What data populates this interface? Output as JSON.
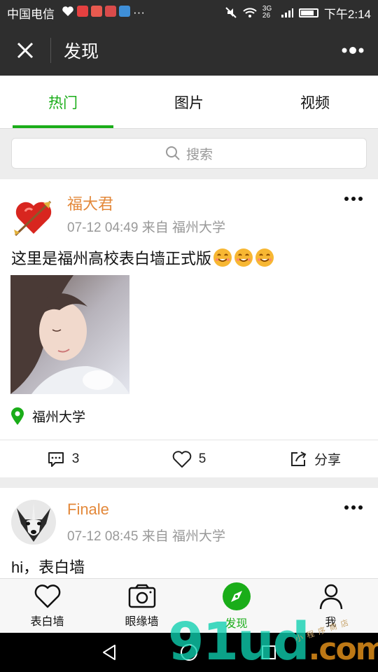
{
  "status_bar": {
    "carrier": "中国电信",
    "time": "下午2:14",
    "network": "3G 26"
  },
  "nav": {
    "title": "发现"
  },
  "tabs": [
    {
      "label": "热门",
      "active": true
    },
    {
      "label": "图片",
      "active": false
    },
    {
      "label": "视频",
      "active": false
    }
  ],
  "search": {
    "placeholder": "搜索"
  },
  "posts": [
    {
      "author": "福大君",
      "meta": "07-12 04:49 来自 福州大学",
      "text": "这里是福州高校表白墙正式版",
      "location": "福州大学",
      "comments": "3",
      "likes": "5",
      "share_label": "分享"
    },
    {
      "author": "Finale",
      "meta": "07-12 08:45 来自 福州大学",
      "text": "hi，表白墙"
    }
  ],
  "bottom_tabs": [
    {
      "label": "表白墙",
      "icon": "heart-icon"
    },
    {
      "label": "眼缘墙",
      "icon": "camera-icon"
    },
    {
      "label": "发现",
      "icon": "compass-icon",
      "active": true
    },
    {
      "label": "我",
      "icon": "person-icon"
    }
  ],
  "watermark": {
    "main": "91ud",
    "suffix": ".com",
    "small": "小程序商店"
  },
  "colors": {
    "accent": "#1aad19",
    "author": "#e3883a",
    "nav_bg": "#2e2e2e"
  }
}
